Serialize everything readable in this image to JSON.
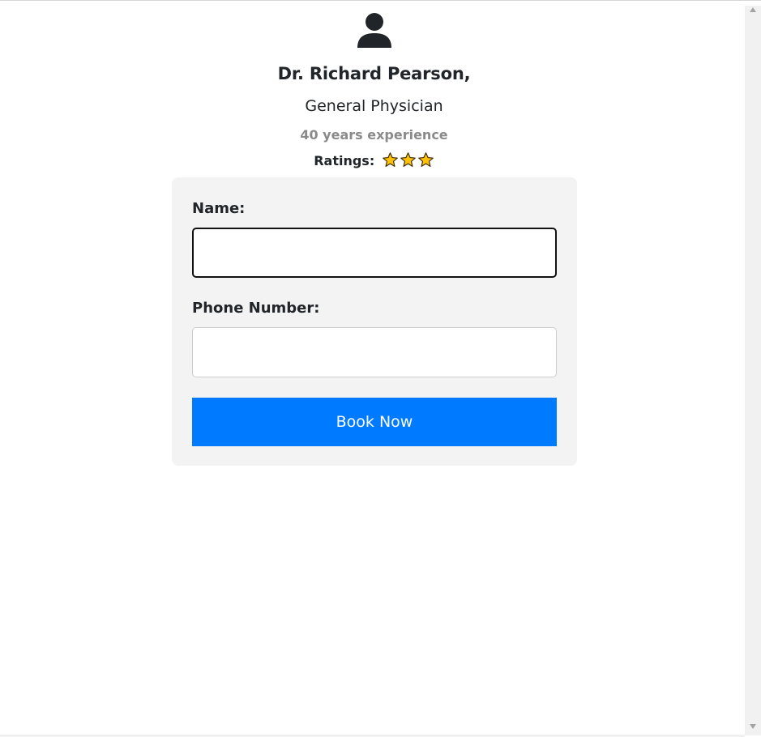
{
  "doctor": {
    "avatar_icon": "user-icon",
    "name": "Dr. Richard Pearson,",
    "specialty": "General Physician",
    "experience": "40 years experience",
    "ratings_label": "Ratings:",
    "rating_stars": 3,
    "star_icon": "star-icon",
    "star_color": "#ffc107"
  },
  "form": {
    "name_label": "Name:",
    "name_value": "",
    "phone_label": "Phone Number:",
    "phone_value": "",
    "submit_label": "Book Now",
    "submit_color": "#007bff"
  }
}
